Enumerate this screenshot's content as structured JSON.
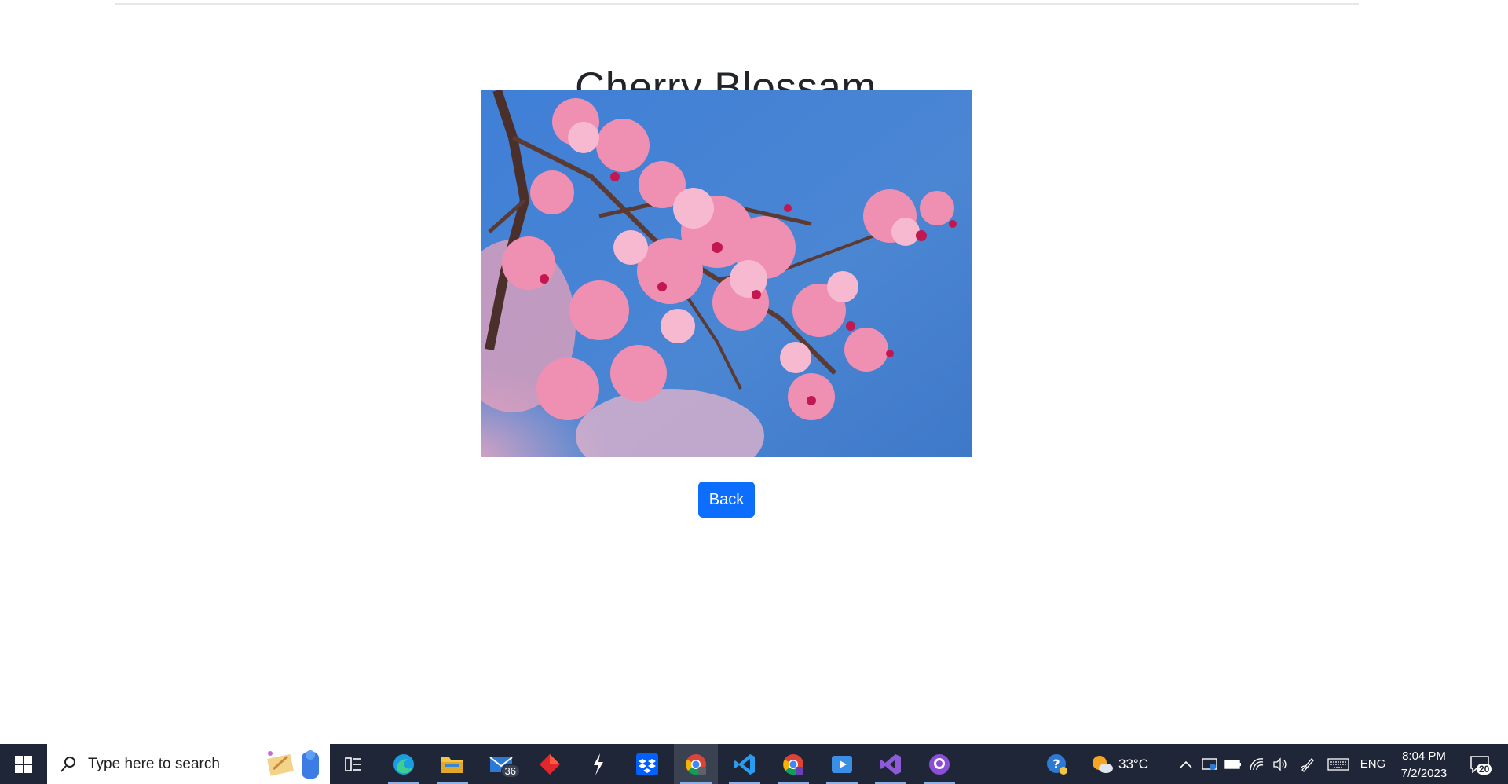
{
  "page": {
    "title": "Cherry Blossam",
    "back_label": "Back"
  },
  "taskbar": {
    "search_placeholder": "Type here to search",
    "mail_badge": "36",
    "weather_temp": "33°C",
    "language": "ENG",
    "time": "8:04 PM",
    "date": "7/2/2023",
    "notification_count": "20",
    "apps": [
      "edge",
      "file-explorer",
      "mail",
      "app-red",
      "app-lightning",
      "dropbox",
      "chrome",
      "vscode",
      "chrome-profile",
      "media-player",
      "visual-studio",
      "github-desktop"
    ]
  }
}
